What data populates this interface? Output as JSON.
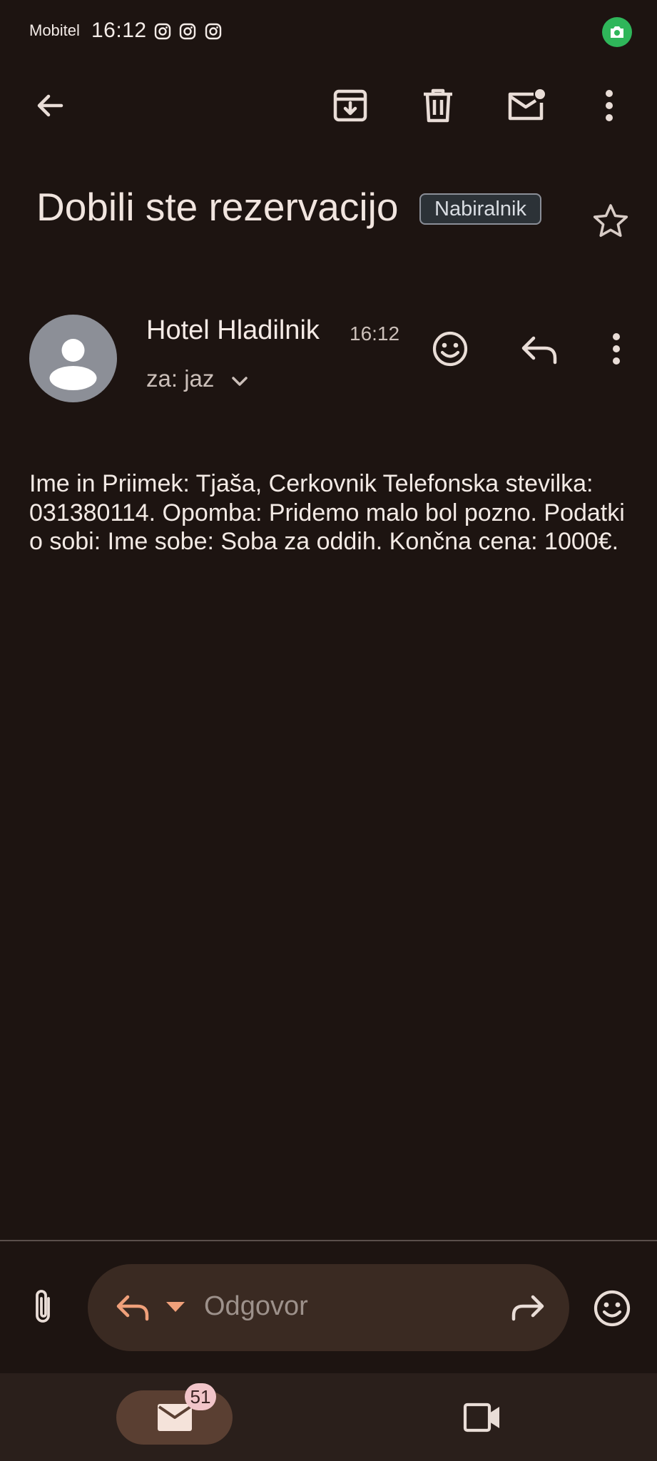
{
  "status_bar": {
    "carrier": "Mobitel",
    "time": "16:12",
    "notification_icons": [
      "instagram-icon",
      "instagram-icon",
      "instagram-icon"
    ],
    "camera_indicator_color": "#2fb65a"
  },
  "toolbar": {
    "back_icon": "arrow-left-icon",
    "actions": [
      "archive-icon",
      "delete-icon",
      "mark-unread-icon",
      "more-vert-icon"
    ]
  },
  "email": {
    "subject": "Dobili ste rezervacijo",
    "label": "Nabiralnik",
    "sender": "Hotel Hladilnik",
    "time": "16:12",
    "recipient": "za: jaz",
    "body": "Ime in Priimek: Tjaša, Cerkovnik Telefonska stevilka: 031380114. Opomba: Pridemo malo bol pozno. Podatki o sobi: Ime sobe: Soba za oddih. Končna cena: 1000€."
  },
  "reply_bar": {
    "placeholder": "Odgovor",
    "accent_color": "#f0a07a"
  },
  "bottom_nav": {
    "mail_badge": "51",
    "items": [
      "mail-icon",
      "video-camera-icon"
    ]
  }
}
